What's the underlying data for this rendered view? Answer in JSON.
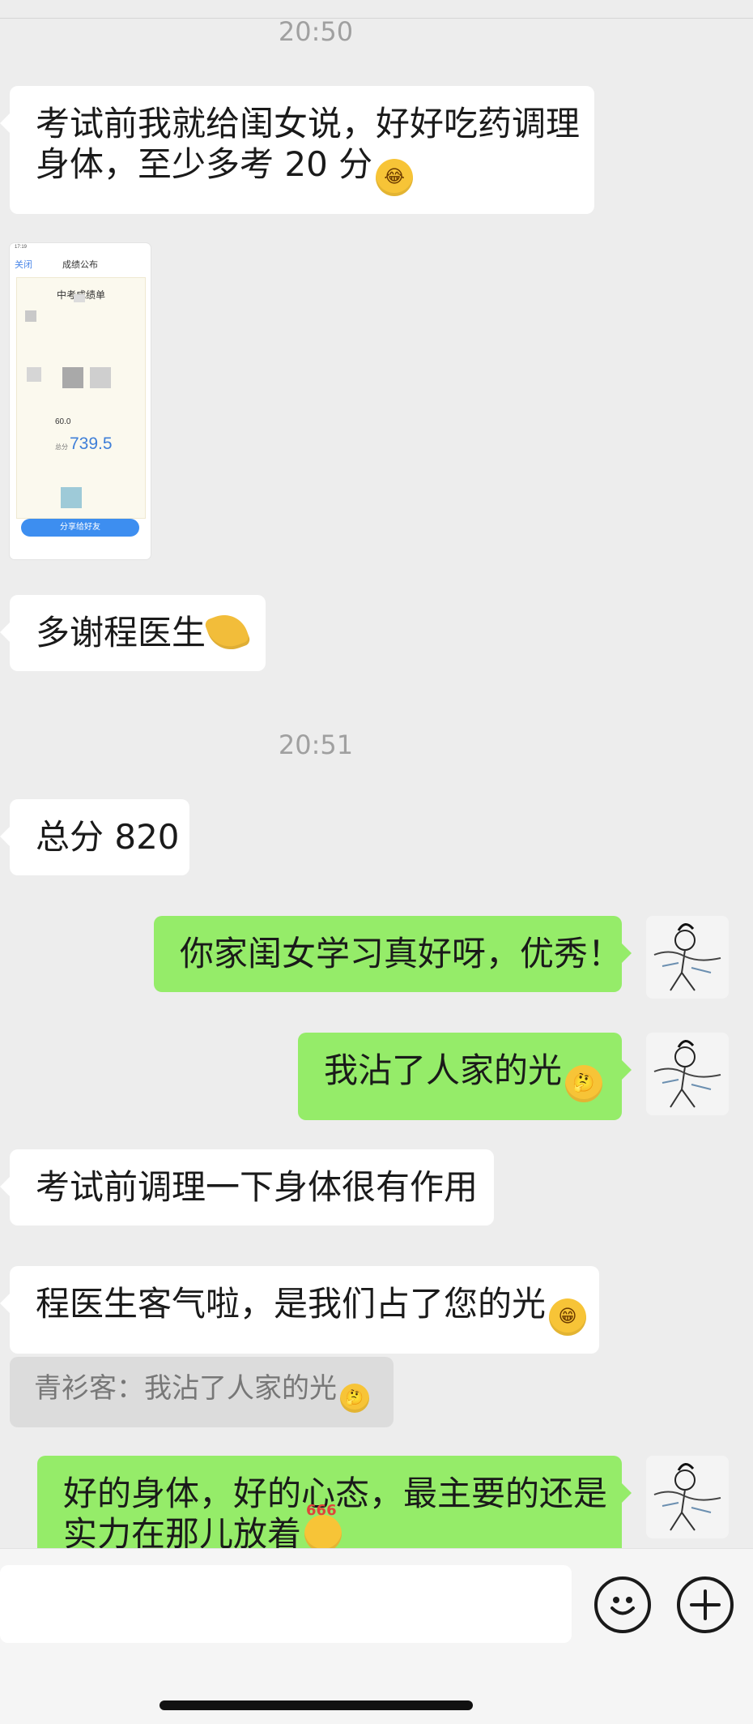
{
  "timestamps": [
    "20:50",
    "20:51"
  ],
  "messages": {
    "m1_line1": "考试前我就给闺女说，好好吃药调理",
    "m1_line2": "身体，至少多考 20 分",
    "m3": "多谢程医生",
    "m4": "总分 820",
    "m5": "你家闺女学习真好呀，优秀！",
    "m6": "我沾了人家的光",
    "m7": "考试前调理一下身体很有作用",
    "m8": "程医生客气啦，是我们占了您的光",
    "quote": "青衫客：我沾了人家的光",
    "m9_line1": "好的身体，好的心态，最主要的还是",
    "m9_line2": "实力在那儿放着"
  },
  "screenshot": {
    "status": "17:19",
    "back": "关闭",
    "title": "成绩公布",
    "card_title": "中考成绩单",
    "item_value": "60.0",
    "total_label": "总分",
    "total_value": "739.5",
    "share_button": "分享给好友"
  },
  "emoji_badge_666": "666",
  "icons": {
    "emoji_button": "smiley-face-icon",
    "plus_button": "plus-circle-icon"
  },
  "colors": {
    "background": "#ededed",
    "incoming_bubble": "#ffffff",
    "outgoing_bubble": "#95ec69",
    "quote_bubble": "#dcdcdc",
    "timestamp": "#a0a0a0"
  }
}
